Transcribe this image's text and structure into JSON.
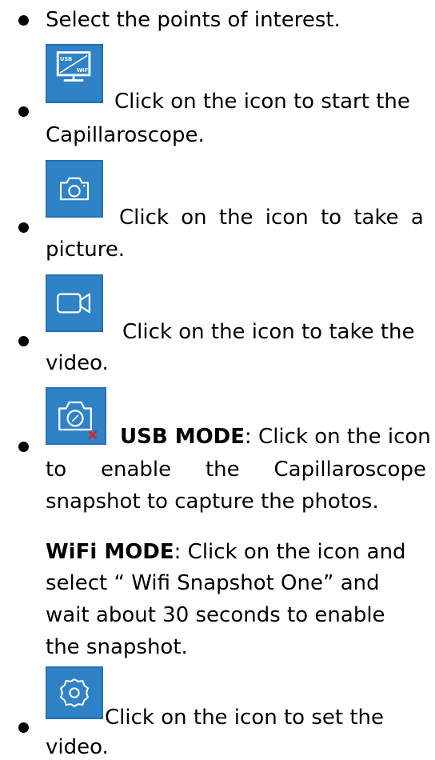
{
  "items": [
    {
      "line1": "Select the points of interest."
    },
    {
      "icon": "usb-wifi-monitor-icon",
      "line1": "Click on the icon to start the",
      "line2": "Capillaroscope."
    },
    {
      "icon": "camera-icon",
      "line1": "Click on the icon to take a",
      "line2": "picture."
    },
    {
      "icon": "video-camera-icon",
      "line1": "Click on the icon to take the",
      "line2": "video."
    },
    {
      "icon": "snapshot-camera-icon",
      "usb_label": "USB MODE",
      "usb_text": ": Click on the icon",
      "line2_words": [
        "to",
        "enable",
        "the",
        "Capillaroscope"
      ],
      "line3": "snapshot to capture the photos.",
      "wifi_label": "WiFi MODE",
      "wifi_text": ": Click on the icon and",
      "wifi_line2": "select “ Wifi Snapshot One” and",
      "wifi_line3": "wait about 30 seconds  to enable",
      "wifi_line4": "the snapshot."
    },
    {
      "icon": "settings-gear-icon",
      "line1": "Click on the icon to set the",
      "line2": "video."
    }
  ],
  "icon_mini_text": {
    "usb": "USB",
    "wifi": "WIFI"
  },
  "colors": {
    "icon_blue": "#2f82c6",
    "icon_border": "#2670ad",
    "icon_line": "#ffffff",
    "x_mark": "#e02020"
  }
}
